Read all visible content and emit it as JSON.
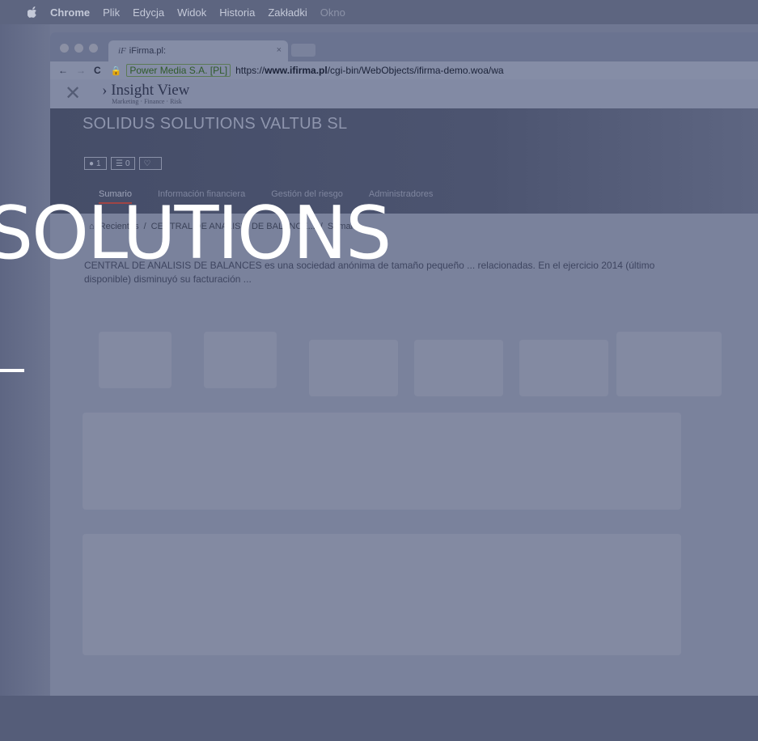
{
  "menubar": {
    "items": [
      "Chrome",
      "Plik",
      "Edycja",
      "Widok",
      "Historia",
      "Zakładki",
      "Okno"
    ]
  },
  "browser": {
    "tab_title": "iFirma.pl:",
    "tab_favicon": "iF",
    "tab_close": "×",
    "certificate": "Power Media S.A. [PL]",
    "url_prefix": "https://",
    "url_host": "www.ifirma.pl",
    "url_path": "/cgi-bin/WebObjects/ifirma-demo.woa/wa"
  },
  "app": {
    "logo": "Insight View",
    "logo_tag": "Marketing · Finance · Risk",
    "company_name": "SOLIDUS SOLUTIONS VALTUB SL",
    "badges": [
      {
        "icon": "tag-icon",
        "count": "1"
      },
      {
        "icon": "list-icon",
        "count": "0"
      },
      {
        "icon": "heart-icon",
        "count": ""
      }
    ],
    "tabs": [
      "Sumario",
      "Información financiera",
      "Gestión del riesgo",
      "Administradores"
    ],
    "breadcrumb": [
      "Recientes",
      "CENTRAL DE ANALISIS DE BALANCE...",
      "Sumario"
    ],
    "description": "CENTRAL DE ANALISIS DE BALANCES es una sociedad anónima de tamaño pequeño ... relacionadas. En el ejercicio 2014 (último disponible) disminuyó su facturación ..."
  },
  "overlay": {
    "title": "SOLUTIONS"
  },
  "colors": {
    "overlay_text": "#ffffff",
    "active_tab_underline": "#a04545",
    "tint": "#6f7792"
  }
}
